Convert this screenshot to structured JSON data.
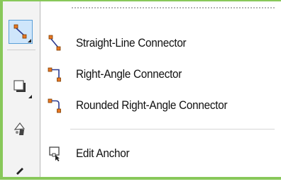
{
  "toolbox": {
    "tools": [
      {
        "icon": "connector-tool-icon",
        "active": true
      },
      {
        "icon": "shadow-tool-icon",
        "active": false
      },
      {
        "icon": "fill-tool-icon",
        "active": false
      }
    ]
  },
  "menu": {
    "items": [
      {
        "label": "Straight-Line Connector",
        "icon": "straight-line-connector-icon"
      },
      {
        "label": "Right-Angle Connector",
        "icon": "right-angle-connector-icon"
      },
      {
        "label": "Rounded Right-Angle Connector",
        "icon": "rounded-right-angle-connector-icon"
      },
      {
        "label": "Edit Anchor",
        "icon": "edit-anchor-icon"
      }
    ]
  },
  "colors": {
    "frame": "#88c85a",
    "node": "#e87722",
    "active_bg": "#cfe6fb"
  }
}
